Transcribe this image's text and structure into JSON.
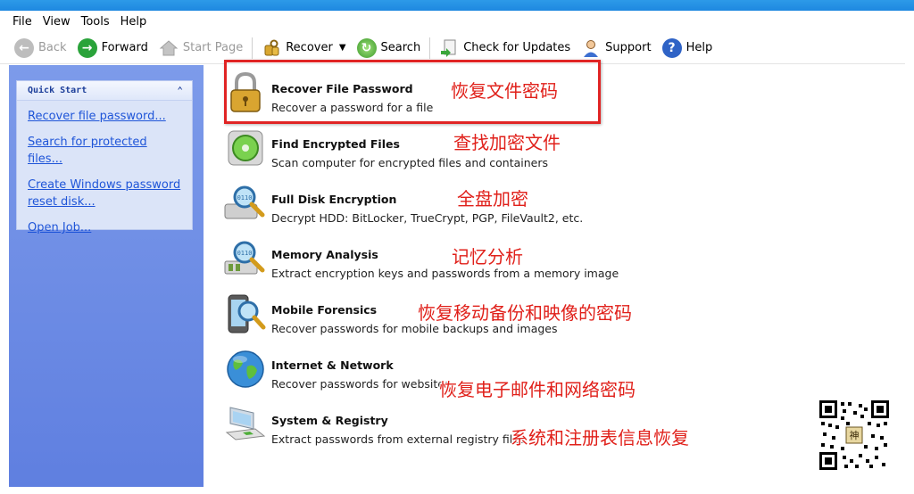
{
  "menu": [
    "File",
    "View",
    "Tools",
    "Help"
  ],
  "toolbar": {
    "back": "Back",
    "forward": "Forward",
    "start_page": "Start Page",
    "recover": "Recover",
    "search": "Search",
    "check_updates": "Check for Updates",
    "support": "Support",
    "help": "Help"
  },
  "quick_start": {
    "title": "Quick Start",
    "links": [
      "Recover file password...",
      "Search for protected files...",
      "Create Windows password reset disk...",
      "Open Job..."
    ]
  },
  "tasks": [
    {
      "title": "Recover File Password",
      "desc": "Recover a password for a file",
      "icon": "padlock-icon",
      "annotation": "恢复文件密码"
    },
    {
      "title": "Find Encrypted Files",
      "desc": "Scan computer for encrypted files and containers",
      "icon": "disk-search-icon",
      "annotation": "查找加密文件"
    },
    {
      "title": "Full Disk Encryption",
      "desc": "Decrypt HDD: BitLocker, TrueCrypt, PGP, FileVault2, etc.",
      "icon": "hdd-magnifier-icon",
      "annotation": "全盘加密"
    },
    {
      "title": "Memory Analysis",
      "desc": "Extract encryption keys and passwords from a memory image",
      "icon": "memory-magnifier-icon",
      "annotation": "记忆分析"
    },
    {
      "title": "Mobile Forensics",
      "desc": "Recover passwords for mobile backups and images",
      "icon": "phone-magnifier-icon",
      "annotation": "恢复移动备份和映像的密码"
    },
    {
      "title": "Internet & Network",
      "desc": "Recover passwords for websites",
      "icon": "globe-icon",
      "annotation": "恢复电子邮件和网络密码"
    },
    {
      "title": "System & Registry",
      "desc": "Extract passwords from external registry files",
      "icon": "computer-icon",
      "annotation": "系统和注册表信息恢复"
    }
  ],
  "colors": {
    "accent_blue": "#2d9ae8",
    "panel_blue": "#6f8fe6",
    "link_blue": "#1f55d8",
    "annotation_red": "#e0201a"
  }
}
